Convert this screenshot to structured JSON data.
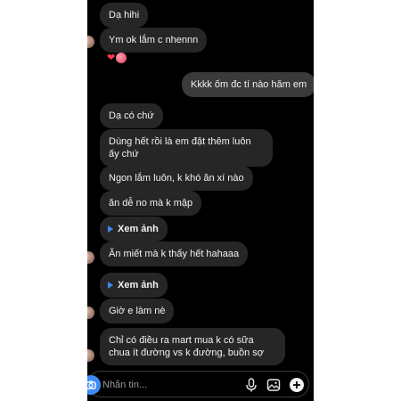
{
  "messages": {
    "m1": "Dạ hihi",
    "m2": "Ym ok lắm c nhennn",
    "m3": "Kkkk ốm đc tí nào hăm em",
    "m4": "Dạ có chứ",
    "m5": "Dùng hết rồi là em đặt thêm luôn ấy chứ",
    "m6": "Ngon lắm luôn, k khó ăn xí nào",
    "m7": "ăn dễ no mà k mập",
    "m8": "Ăn miết mà k thấy hết hahaaa",
    "m9": "Giờ e làm nè",
    "m10": "Chỉ có điều ra mart mua k có sữa chua ít đường vs k đường, buồn sợ"
  },
  "photo_link_label": "Xem ảnh",
  "reactions": {
    "heart": "❤"
  },
  "composer": {
    "placeholder": "Nhắn tin..."
  },
  "icons": [
    "play-icon",
    "camera-icon",
    "microphone-icon",
    "image-icon",
    "add-icon"
  ],
  "colors": {
    "background": "#000000",
    "bubble_incoming": "#262626",
    "bubble_outgoing": "#3a3a3a",
    "accent": "#3d8bf5",
    "text": "#f2f2f2"
  }
}
